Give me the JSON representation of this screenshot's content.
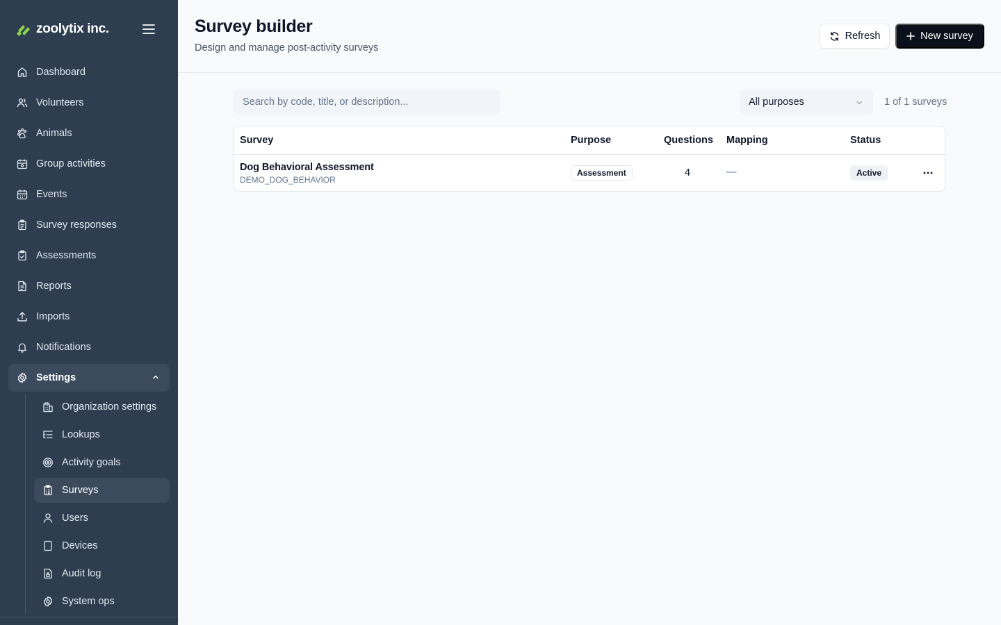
{
  "brand": {
    "name": "zoolytix inc.",
    "logo_icon": "leaf-logo",
    "accent": "#8bd450"
  },
  "sidebar": {
    "items": [
      {
        "label": "Dashboard",
        "icon": "home-icon"
      },
      {
        "label": "Volunteers",
        "icon": "users-icon"
      },
      {
        "label": "Animals",
        "icon": "paw-icon"
      },
      {
        "label": "Group activities",
        "icon": "calendar-group-icon"
      },
      {
        "label": "Events",
        "icon": "calendar-icon"
      },
      {
        "label": "Survey responses",
        "icon": "clipboard-icon"
      },
      {
        "label": "Assessments",
        "icon": "clipboard-check-icon"
      },
      {
        "label": "Reports",
        "icon": "file-text-icon"
      },
      {
        "label": "Imports",
        "icon": "upload-icon"
      },
      {
        "label": "Notifications",
        "icon": "bell-icon"
      }
    ],
    "settings": {
      "label": "Settings",
      "icon": "gear-icon",
      "expanded": true,
      "children": [
        {
          "label": "Organization settings",
          "icon": "building-icon"
        },
        {
          "label": "Lookups",
          "icon": "list-tree-icon"
        },
        {
          "label": "Activity goals",
          "icon": "target-icon"
        },
        {
          "label": "Surveys",
          "icon": "clipboard-list-icon",
          "active": true
        },
        {
          "label": "Users",
          "icon": "user-icon"
        },
        {
          "label": "Devices",
          "icon": "tablet-icon"
        },
        {
          "label": "Audit log",
          "icon": "file-lock-icon"
        },
        {
          "label": "System ops",
          "icon": "gear-icon"
        }
      ]
    }
  },
  "header": {
    "title": "Survey builder",
    "subtitle": "Design and manage post-activity surveys",
    "refresh_label": "Refresh",
    "new_label": "New survey"
  },
  "toolbar": {
    "search_placeholder": "Search by code, title, or description...",
    "search_value": "",
    "purpose_filter": "All purposes",
    "count_text": "1 of 1 surveys"
  },
  "table": {
    "columns": [
      "Survey",
      "Purpose",
      "Questions",
      "Mapping",
      "Status"
    ],
    "rows": [
      {
        "title": "Dog Behavioral Assessment",
        "code": "DEMO_DOG_BEHAVIOR",
        "purpose": "Assessment",
        "questions": "4",
        "mapping": "—",
        "status": "Active"
      }
    ]
  }
}
